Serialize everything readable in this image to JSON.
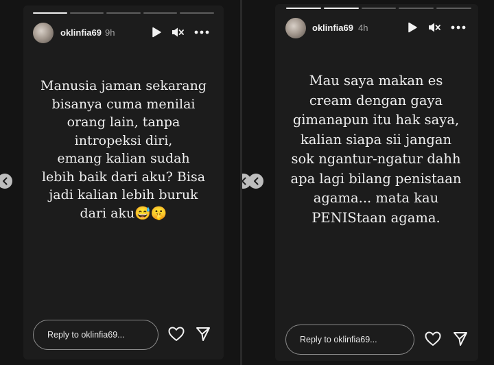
{
  "left_story": {
    "username": "oklinfia69",
    "time": "9h",
    "progress_segments": 5,
    "active_segment": 1,
    "lines": [
      "Manusia jaman sekarang",
      "bisanya cuma menilai",
      "orang lain, tanpa",
      "intropeksi diri,",
      "emang kalian sudah",
      "lebih baik dari aku? Bisa",
      "jadi kalian lebih buruk",
      "dari aku😅🤫"
    ],
    "reply_placeholder": "Reply to oklinfia69..."
  },
  "right_story": {
    "username": "oklinfia69",
    "time": "4h",
    "progress_segments": 5,
    "active_segment": 2,
    "lines": [
      "Mau saya makan es",
      "cream dengan gaya",
      "gimanapun itu hak saya,",
      "kalian siapa sii jangan",
      "sok ngantur-ngatur dahh",
      "apa lagi bilang penistaan",
      "agama... mata kau",
      "PENIStaan agama."
    ],
    "reply_placeholder": "Reply to oklinfia69..."
  },
  "icons": {
    "play": "play-icon",
    "mute": "speaker-muted-icon",
    "more": "more-horizontal-icon",
    "like": "heart-icon",
    "share": "paper-plane-icon",
    "previous": "chevron-left-icon"
  },
  "colors": {
    "background": "#141414",
    "card": "#1c1c1c",
    "text": "#efefef",
    "progress_active": "#f0f0f0",
    "progress_inactive": "#5e5e5e"
  }
}
